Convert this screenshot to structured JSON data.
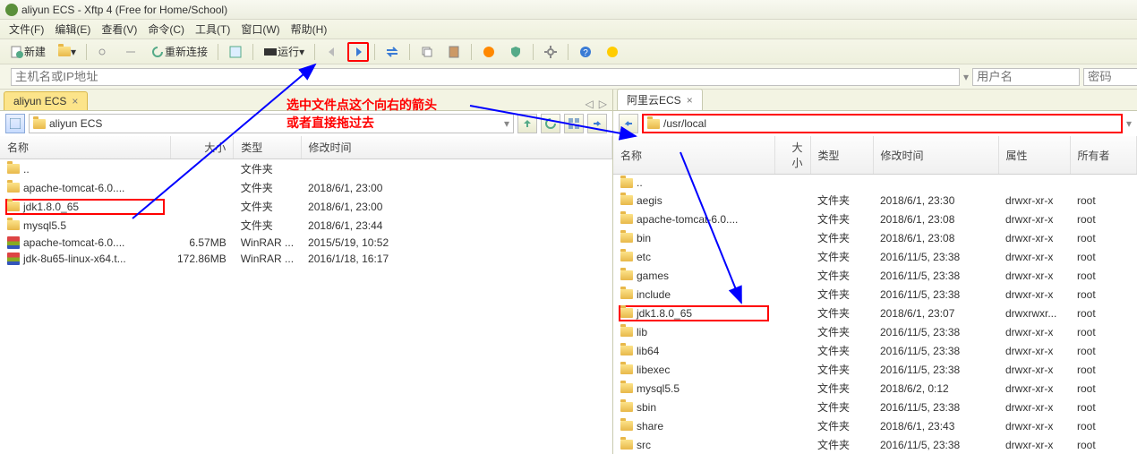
{
  "title": "aliyun ECS - Xftp 4 (Free for Home/School)",
  "menus": [
    "文件(F)",
    "编辑(E)",
    "查看(V)",
    "命令(C)",
    "工具(T)",
    "窗口(W)",
    "帮助(H)"
  ],
  "toolbar": {
    "new_label": "新建",
    "reconnect_label": "重新连接",
    "run_label": "运行"
  },
  "addr": {
    "host_placeholder": "主机名或IP地址",
    "user_placeholder": "用户名",
    "pwd_placeholder": "密码"
  },
  "annotation": {
    "line1": "选中文件点这个向右的箭头",
    "line2": "或者直接拖过去"
  },
  "left": {
    "tab": "aliyun ECS",
    "path_label": "aliyun ECS",
    "cols": [
      "名称",
      "大小",
      "类型",
      "修改时间"
    ],
    "rows": [
      {
        "icon": "folder",
        "name": "..",
        "size": "",
        "type": "文件夹",
        "mtime": ""
      },
      {
        "icon": "folder",
        "name": "apache-tomcat-6.0....",
        "size": "",
        "type": "文件夹",
        "mtime": "2018/6/1, 23:00"
      },
      {
        "icon": "folder",
        "name": "jdk1.8.0_65",
        "size": "",
        "type": "文件夹",
        "mtime": "2018/6/1, 23:00",
        "highlight": true
      },
      {
        "icon": "folder",
        "name": "mysql5.5",
        "size": "",
        "type": "文件夹",
        "mtime": "2018/6/1, 23:44"
      },
      {
        "icon": "rar",
        "name": "apache-tomcat-6.0....",
        "size": "6.57MB",
        "type": "WinRAR ...",
        "mtime": "2015/5/19, 10:52"
      },
      {
        "icon": "rar",
        "name": "jdk-8u65-linux-x64.t...",
        "size": "172.86MB",
        "type": "WinRAR ...",
        "mtime": "2016/1/18, 16:17"
      }
    ]
  },
  "right": {
    "tab": "阿里云ECS",
    "path_label": "/usr/local",
    "cols": [
      "名称",
      "大小",
      "类型",
      "修改时间",
      "属性",
      "所有者"
    ],
    "rows": [
      {
        "name": "..",
        "type": "",
        "mtime": "",
        "perm": "",
        "owner": ""
      },
      {
        "name": "aegis",
        "type": "文件夹",
        "mtime": "2018/6/1, 23:30",
        "perm": "drwxr-xr-x",
        "owner": "root"
      },
      {
        "name": "apache-tomcat-6.0....",
        "type": "文件夹",
        "mtime": "2018/6/1, 23:08",
        "perm": "drwxr-xr-x",
        "owner": "root"
      },
      {
        "name": "bin",
        "type": "文件夹",
        "mtime": "2018/6/1, 23:08",
        "perm": "drwxr-xr-x",
        "owner": "root"
      },
      {
        "name": "etc",
        "type": "文件夹",
        "mtime": "2016/11/5, 23:38",
        "perm": "drwxr-xr-x",
        "owner": "root"
      },
      {
        "name": "games",
        "type": "文件夹",
        "mtime": "2016/11/5, 23:38",
        "perm": "drwxr-xr-x",
        "owner": "root"
      },
      {
        "name": "include",
        "type": "文件夹",
        "mtime": "2016/11/5, 23:38",
        "perm": "drwxr-xr-x",
        "owner": "root"
      },
      {
        "name": "jdk1.8.0_65",
        "type": "文件夹",
        "mtime": "2018/6/1, 23:07",
        "perm": "drwxrwxr...",
        "owner": "root",
        "highlight": true
      },
      {
        "name": "lib",
        "type": "文件夹",
        "mtime": "2016/11/5, 23:38",
        "perm": "drwxr-xr-x",
        "owner": "root"
      },
      {
        "name": "lib64",
        "type": "文件夹",
        "mtime": "2016/11/5, 23:38",
        "perm": "drwxr-xr-x",
        "owner": "root"
      },
      {
        "name": "libexec",
        "type": "文件夹",
        "mtime": "2016/11/5, 23:38",
        "perm": "drwxr-xr-x",
        "owner": "root"
      },
      {
        "name": "mysql5.5",
        "type": "文件夹",
        "mtime": "2018/6/2, 0:12",
        "perm": "drwxr-xr-x",
        "owner": "root"
      },
      {
        "name": "sbin",
        "type": "文件夹",
        "mtime": "2016/11/5, 23:38",
        "perm": "drwxr-xr-x",
        "owner": "root"
      },
      {
        "name": "share",
        "type": "文件夹",
        "mtime": "2018/6/1, 23:43",
        "perm": "drwxr-xr-x",
        "owner": "root"
      },
      {
        "name": "src",
        "type": "文件夹",
        "mtime": "2016/11/5, 23:38",
        "perm": "drwxr-xr-x",
        "owner": "root"
      }
    ]
  }
}
